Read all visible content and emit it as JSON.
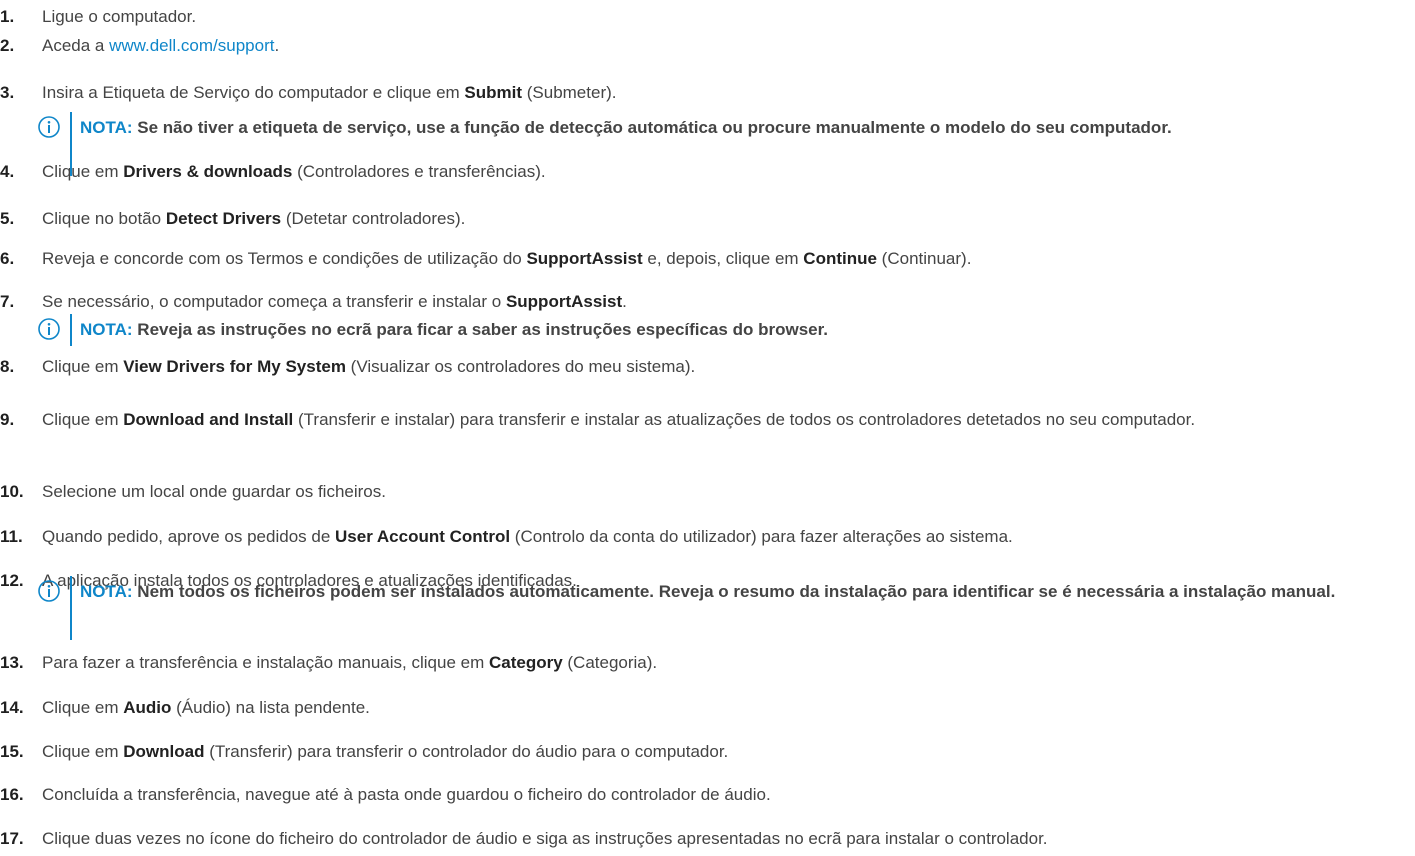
{
  "steps": [
    {
      "num": "1.",
      "parts": [
        {
          "t": "Ligue o computador."
        }
      ]
    },
    {
      "num": "2.",
      "parts": [
        {
          "t": "Aceda a "
        },
        {
          "t": "www.dell.com/support",
          "link": true
        },
        {
          "t": "."
        }
      ]
    },
    {
      "num": "3.",
      "parts": [
        {
          "t": "Insira a Etiqueta de Serviço do computador e clique em "
        },
        {
          "t": "Submit",
          "b": true
        },
        {
          "t": " (Submeter)."
        }
      ]
    },
    {
      "num": "4.",
      "parts": [
        {
          "t": "Clique em "
        },
        {
          "t": "Drivers & downloads",
          "b": true
        },
        {
          "t": " (Controladores e transferências)."
        }
      ]
    },
    {
      "num": "5.",
      "parts": [
        {
          "t": "Clique no botão "
        },
        {
          "t": "Detect Drivers",
          "b": true
        },
        {
          "t": " (Detetar controladores)."
        }
      ]
    },
    {
      "num": "6.",
      "parts": [
        {
          "t": "Reveja e concorde com os Termos e condições de utilização do "
        },
        {
          "t": "SupportAssist",
          "b": true
        },
        {
          "t": " e, depois, clique em "
        },
        {
          "t": "Continue",
          "b": true
        },
        {
          "t": " (Continuar)."
        }
      ]
    },
    {
      "num": "7.",
      "parts": [
        {
          "t": "Se necessário, o computador começa a transferir e instalar o "
        },
        {
          "t": "SupportAssist",
          "b": true
        },
        {
          "t": "."
        }
      ]
    },
    {
      "num": "8.",
      "parts": [
        {
          "t": "Clique em "
        },
        {
          "t": "View Drivers for My System",
          "b": true
        },
        {
          "t": " (Visualizar os controladores do meu sistema)."
        }
      ]
    },
    {
      "num": "9.",
      "parts": [
        {
          "t": "Clique em "
        },
        {
          "t": "Download and Install",
          "b": true
        },
        {
          "t": " (Transferir e instalar) para transferir e instalar as atualizações de todos os controladores detetados no seu computador."
        }
      ]
    },
    {
      "num": "10.",
      "parts": [
        {
          "t": "Selecione um local onde guardar os ficheiros."
        }
      ]
    },
    {
      "num": "11.",
      "parts": [
        {
          "t": "Quando pedido, aprove os pedidos de "
        },
        {
          "t": "User Account Control",
          "b": true
        },
        {
          "t": " (Controlo da conta do utilizador) para fazer alterações ao sistema."
        }
      ]
    },
    {
      "num": "12.",
      "parts": [
        {
          "t": "A aplicação instala todos os controladores e atualizações identificadas."
        }
      ]
    },
    {
      "num": "13.",
      "parts": [
        {
          "t": "Para fazer a transferência e instalação manuais, clique em "
        },
        {
          "t": "Category",
          "b": true
        },
        {
          "t": " (Categoria)."
        }
      ]
    },
    {
      "num": "14.",
      "parts": [
        {
          "t": "Clique em "
        },
        {
          "t": "Audio",
          "b": true
        },
        {
          "t": " (Áudio) na lista pendente."
        }
      ]
    },
    {
      "num": "15.",
      "parts": [
        {
          "t": "Clique em "
        },
        {
          "t": "Download",
          "b": true
        },
        {
          "t": " (Transferir) para transferir o controlador do áudio para o computador."
        }
      ]
    },
    {
      "num": "16.",
      "parts": [
        {
          "t": "Concluída a transferência, navegue até à pasta onde guardou o ficheiro do controlador de áudio."
        }
      ]
    },
    {
      "num": "17.",
      "parts": [
        {
          "t": "Clique duas vezes no ícone do ficheiro do controlador de áudio e siga as instruções apresentadas no ecrã para instalar o controlador."
        }
      ]
    }
  ],
  "notes": [
    {
      "label": "NOTA:",
      "text": " Se não tiver a etiqueta de serviço, use a função de detecção automática ou procure manualmente o modelo do seu computador."
    },
    {
      "label": "NOTA:",
      "text": " Reveja as instruções no ecrã para ficar a saber as instruções específicas do browser."
    },
    {
      "label": "NOTA:",
      "text": " Nem todos os ficheiros podem ser instalados automaticamente. Reveja o resumo da instalação para identificar se é necessária a instalação manual."
    }
  ],
  "colors": {
    "accent": "#0f86c9",
    "text": "#444444"
  },
  "note_icon": "info-icon"
}
